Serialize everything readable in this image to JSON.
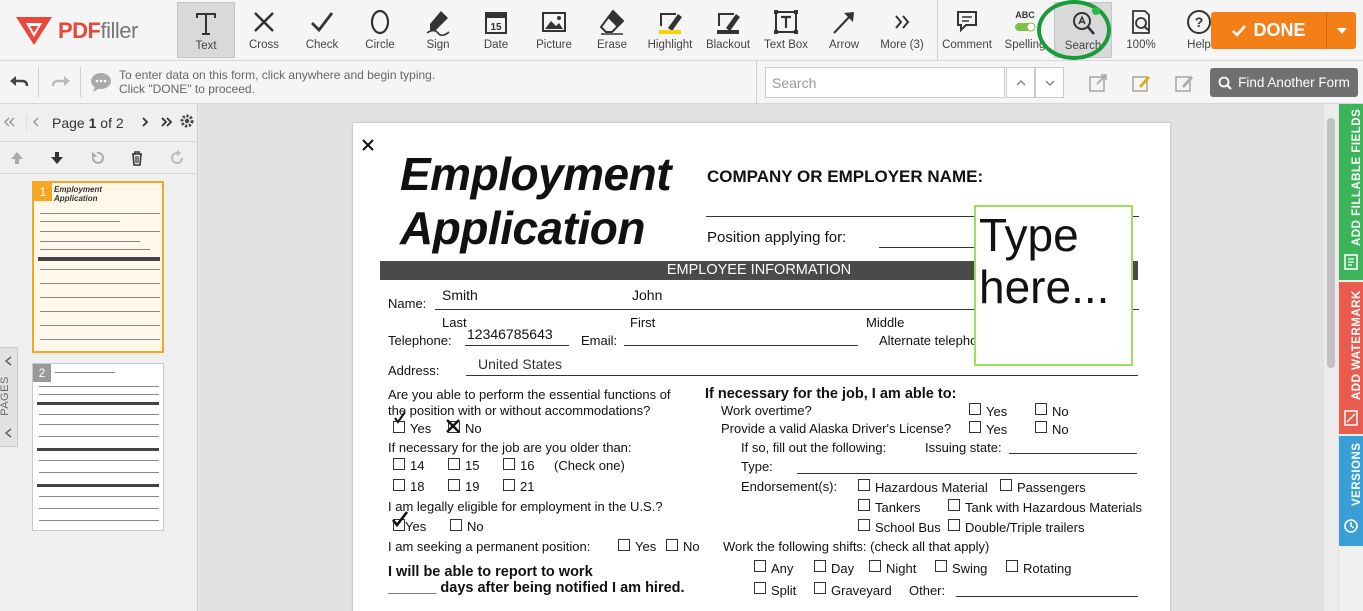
{
  "app": {
    "logo_text_main": "PDF",
    "logo_text_sub": "filler"
  },
  "toolbar": {
    "tools": [
      {
        "id": "text",
        "label": "Text"
      },
      {
        "id": "cross",
        "label": "Cross"
      },
      {
        "id": "check",
        "label": "Check"
      },
      {
        "id": "circle",
        "label": "Circle"
      },
      {
        "id": "sign",
        "label": "Sign"
      },
      {
        "id": "date",
        "label": "Date"
      },
      {
        "id": "picture",
        "label": "Picture"
      },
      {
        "id": "erase",
        "label": "Erase"
      },
      {
        "id": "highlight",
        "label": "Highlight"
      },
      {
        "id": "blackout",
        "label": "Blackout"
      },
      {
        "id": "textbox",
        "label": "Text Box"
      },
      {
        "id": "arrow",
        "label": "Arrow"
      },
      {
        "id": "more",
        "label": "More (3)"
      }
    ],
    "right_tools": [
      {
        "id": "comment",
        "label": "Comment"
      },
      {
        "id": "spelling",
        "label": "Spelling",
        "badge": "ABC"
      },
      {
        "id": "search",
        "label": "Search"
      },
      {
        "id": "zoom",
        "label": "100%"
      },
      {
        "id": "help",
        "label": "Help"
      }
    ],
    "done_label": "DONE",
    "active_tool": "text",
    "highlighted_tool": "search"
  },
  "subbar": {
    "hint_line1": "To enter data on this form, click anywhere and begin typing.",
    "hint_line2": "Click \"DONE\" to proceed.",
    "search_placeholder": "Search",
    "find_form_label": "Find Another Form"
  },
  "pages_panel": {
    "page_label_prefix": "Page",
    "current_page": "1",
    "page_of": "of 2",
    "side_tab_label": "PAGES",
    "thumbnails": [
      {
        "num": "1"
      },
      {
        "num": "2"
      }
    ]
  },
  "right_tabs": [
    {
      "label": "ADD FILLABLE FIELDS",
      "color": "#3cb55a"
    },
    {
      "label": "ADD WATERMARK",
      "color": "#ea5b4f"
    },
    {
      "label": "VERSIONS",
      "color": "#3a9fd6"
    }
  ],
  "document": {
    "title_line1": "Employment",
    "title_line2": "Application",
    "company_label": "COMPANY OR EMPLOYER NAME:",
    "position_label": "Position applying for:",
    "type_here": "Type here...",
    "section_title": "EMPLOYEE INFORMATION",
    "name_label": "Name:",
    "last_value": "Smith",
    "first_value": "John",
    "last_label": "Last",
    "first_label": "First",
    "middle_label": "Middle",
    "telephone_label": "Telephone:",
    "telephone_value": "12346785643",
    "email_label": "Email:",
    "alt_phone_label": "Alternate telephone:",
    "address_label": "Address:",
    "address_value": "United States",
    "q_essential_1": "Are you able to perform the essential functions of",
    "q_essential_2": "the position with or without accommodations?",
    "yes": "Yes",
    "no": "No",
    "q_older": "If necessary for the job are you older than:",
    "ages": [
      "14",
      "15",
      "16",
      "18",
      "19",
      "21"
    ],
    "check_one": "(Check one)",
    "q_eligible": "I am legally eligible for employment in the U.S.?",
    "q_permanent": "I am seeking a permanent position:",
    "report_1": "I will be able to report to work",
    "report_2": "______ days after being notified I am hired.",
    "if_necessary": "If necessary for the job, I am able to:",
    "work_overtime": "Work overtime?",
    "drivers_license": "Provide a valid Alaska Driver's License?",
    "fill_following": "If so, fill out the following:",
    "issuing_state": "Issuing state:",
    "type_label": "Type:",
    "endorsements_label": "Endorsement(s):",
    "endorsements": [
      "Hazardous Material",
      "Passengers",
      "Tankers",
      "Tank with Hazardous Materials",
      "School Bus",
      "Double/Triple trailers"
    ],
    "shifts_label": "Work the following shifts: (check all that apply)",
    "shifts": [
      "Any",
      "Day",
      "Night",
      "Swing",
      "Rotating",
      "Split",
      "Graveyard"
    ],
    "other_label": "Other:"
  }
}
